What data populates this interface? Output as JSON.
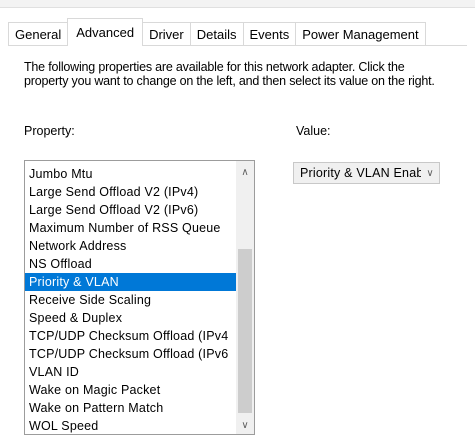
{
  "tabs": [
    {
      "label": "General"
    },
    {
      "label": "Advanced"
    },
    {
      "label": "Driver"
    },
    {
      "label": "Details"
    },
    {
      "label": "Events"
    },
    {
      "label": "Power Management"
    }
  ],
  "active_tab": "Advanced",
  "description": "The following properties are available for this network adapter. Click the property you want to change on the left, and then select its value on the right.",
  "property_label": "Property:",
  "value_label": "Value:",
  "properties": [
    "Jumbo Mtu",
    "Large Send Offload V2 (IPv4)",
    "Large Send Offload V2 (IPv6)",
    "Maximum Number of RSS Queue",
    "Network Address",
    "NS Offload",
    "Priority & VLAN",
    "Receive Side Scaling",
    "Speed & Duplex",
    "TCP/UDP Checksum Offload (IPv4",
    "TCP/UDP Checksum Offload (IPv6",
    "VLAN ID",
    "Wake on Magic Packet",
    "Wake on Pattern Match",
    "WOL Speed"
  ],
  "selected_property": "Priority & VLAN",
  "value": "Priority & VLAN Enabled",
  "icons": {
    "scroll_up": "chevron-up-icon",
    "scroll_down": "chevron-down-icon",
    "dropdown": "chevron-down-icon"
  },
  "colors": {
    "selection": "#0078d7",
    "selection_text": "#ffffff"
  }
}
